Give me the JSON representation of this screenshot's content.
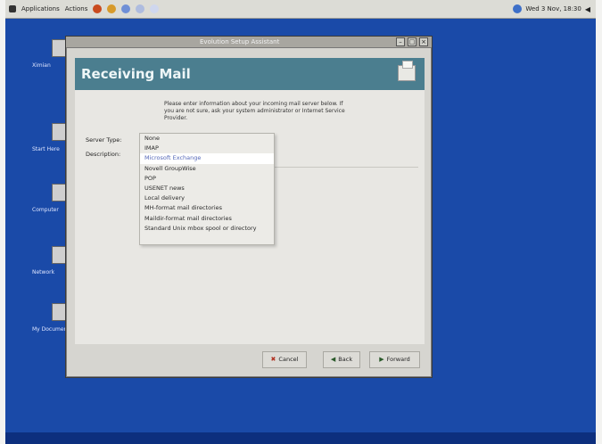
{
  "panel": {
    "menu_applications": "Applications",
    "menu_actions": "Actions",
    "clock": "Wed 3 Nov, 18:30"
  },
  "desktop_icons": [
    {
      "label": "Ximian"
    },
    {
      "label": "Start Here"
    },
    {
      "label": "Computer"
    },
    {
      "label": "Network"
    },
    {
      "label": "My Documents"
    }
  ],
  "window": {
    "title": "Evolution Setup Assistant",
    "header_title": "Receiving Mail",
    "intro_text": "Please enter information about your incoming mail server below. If you are not sure, ask your system administrator or Internet Service Provider.",
    "server_type_label": "Server Type:",
    "description_label": "Description:",
    "server_types": [
      "None",
      "IMAP",
      "Microsoft Exchange",
      "Novell GroupWise",
      "POP",
      "USENET news",
      "Local delivery",
      "MH-format mail directories",
      "Maildir-format mail directories",
      "Standard Unix mbox spool or directory"
    ],
    "selected_index": 2,
    "buttons": {
      "cancel": "Cancel",
      "back": "Back",
      "forward": "Forward"
    }
  },
  "colors": {
    "desktop": "#1a4aa8",
    "header": "#4b7e8f",
    "selection_text": "#5568b8"
  }
}
